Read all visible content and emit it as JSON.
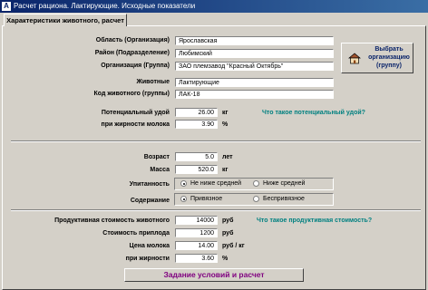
{
  "window": {
    "title": "Расчет рациона. Лактирующие. Исходные показатели",
    "app_icon": "app-icon"
  },
  "tab": {
    "label": "Характеристики животного, расчет"
  },
  "org": {
    "region_label": "Область (Организация)",
    "region_value": "Ярославская",
    "district_label": "Район (Подразделение)",
    "district_value": "Любимский",
    "org_label": "Организация (Группа)",
    "org_value": "ЗАО племзавод \"Красный Октябрь\"",
    "animals_label": "Животные",
    "animals_value": "Лактирующие",
    "code_label": "Код животного (группы)",
    "code_value": "ЛАК-18"
  },
  "org_button": {
    "label": "Выбрать организацию (группу)",
    "icon": "home-icon"
  },
  "yield": {
    "potential_label": "Потенциальный удой",
    "potential_value": "26.00",
    "potential_unit": "кг",
    "potential_link": "Что такое потенциальный удой?",
    "fat_label": "при жирности молока",
    "fat_value": "3.90",
    "fat_unit": "%"
  },
  "animal": {
    "age_label": "Возраст",
    "age_value": "5.0",
    "age_unit": "лет",
    "mass_label": "Масса",
    "mass_value": "520.0",
    "mass_unit": "кг",
    "fatness_label": "Упитанность",
    "fatness_opt1": "Не ниже средней",
    "fatness_opt2": "Ниже средней",
    "fatness_selected": 1,
    "housing_label": "Содержание",
    "housing_opt1": "Привязное",
    "housing_opt2": "Беспривязное",
    "housing_selected": 1
  },
  "economics": {
    "productive_label": "Продуктивная стоимость животного",
    "productive_value": "14000",
    "productive_unit": "руб",
    "productive_link": "Что такое продуктивная стоимость?",
    "offspring_label": "Стоимость приплода",
    "offspring_value": "1200",
    "offspring_unit": "руб",
    "milk_price_label": "Цена молока",
    "milk_price_value": "14.00",
    "milk_price_unit": "руб / кг",
    "fat_label": "при жирности",
    "fat_value": "3.60",
    "fat_unit": "%"
  },
  "actions": {
    "calculate_label": "Задание условий и расчет"
  }
}
